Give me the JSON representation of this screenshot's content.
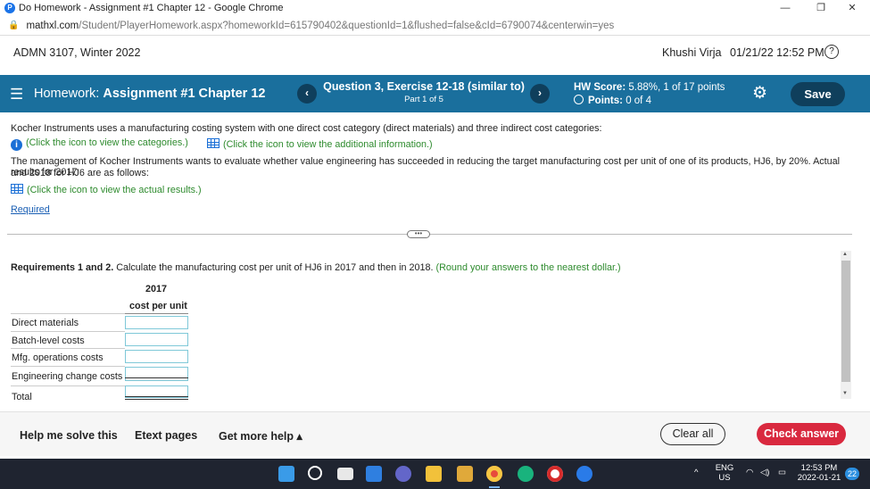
{
  "browser": {
    "tab_title": "Do Homework - Assignment #1 Chapter 12 - Google Chrome",
    "url_host": "mathxl.com",
    "url_path": "/Student/PlayerHomework.aspx?homeworkId=615790402&questionId=1&flushed=false&cId=6790074&centerwin=yes",
    "minimize": "—",
    "restore": "❐",
    "close": "✕"
  },
  "course": {
    "name": "ADMN 3107, Winter 2022",
    "student": "Khushi Virja",
    "datetime": "01/21/22 12:52 PM",
    "help": "?"
  },
  "homework": {
    "label": "Homework:",
    "title": "Assignment #1 Chapter 12",
    "question": "Question 3, Exercise 12-18 (similar to)",
    "part": "Part 1 of 5",
    "score_label": "HW Score:",
    "score_value": "5.88%, 1 of 17 points",
    "points_label": "Points:",
    "points_value": "0 of 4",
    "save": "Save",
    "prev": "‹",
    "next": "›"
  },
  "problem": {
    "intro": "Kocher Instruments uses a manufacturing costing system with one direct cost category (direct materials) and three indirect cost categories:",
    "link_categories": "(Click the icon to view the categories.)",
    "link_additional": "(Click the icon to view the additional information.)",
    "body_line1": "The management of Kocher Instruments wants to evaluate whether value engineering has succeeded in reducing the target manufacturing cost per unit of one of its products, HJ6, by 20%. Actual results for 2017",
    "body_line2": "and 2018 for HJ6 are as follows:",
    "link_actual": "(Click the icon to view the actual results.)",
    "required": "Required"
  },
  "requirements": {
    "label": "Requirements 1 and 2.",
    "text": "Calculate the manufacturing cost per unit of HJ6 in 2017 and then in 2018.",
    "hint": "(Round your answers to the nearest dollar.)",
    "year": "2017",
    "col_header": "cost per unit",
    "rows": [
      {
        "label": "Direct materials",
        "value": ""
      },
      {
        "label": "Batch-level costs",
        "value": ""
      },
      {
        "label": "Mfg. operations costs",
        "value": ""
      },
      {
        "label": "Engineering change costs",
        "value": ""
      },
      {
        "label": "Total",
        "value": ""
      }
    ]
  },
  "footer": {
    "help_solve": "Help me solve this",
    "etext": "Etext pages",
    "more_help": "Get more help ▴",
    "clear_all": "Clear all",
    "check_answer": "Check answer"
  },
  "taskbar": {
    "lang": "ENG",
    "region": "US",
    "time": "12:53 PM",
    "date": "2022-01-21",
    "notifications": "22"
  }
}
